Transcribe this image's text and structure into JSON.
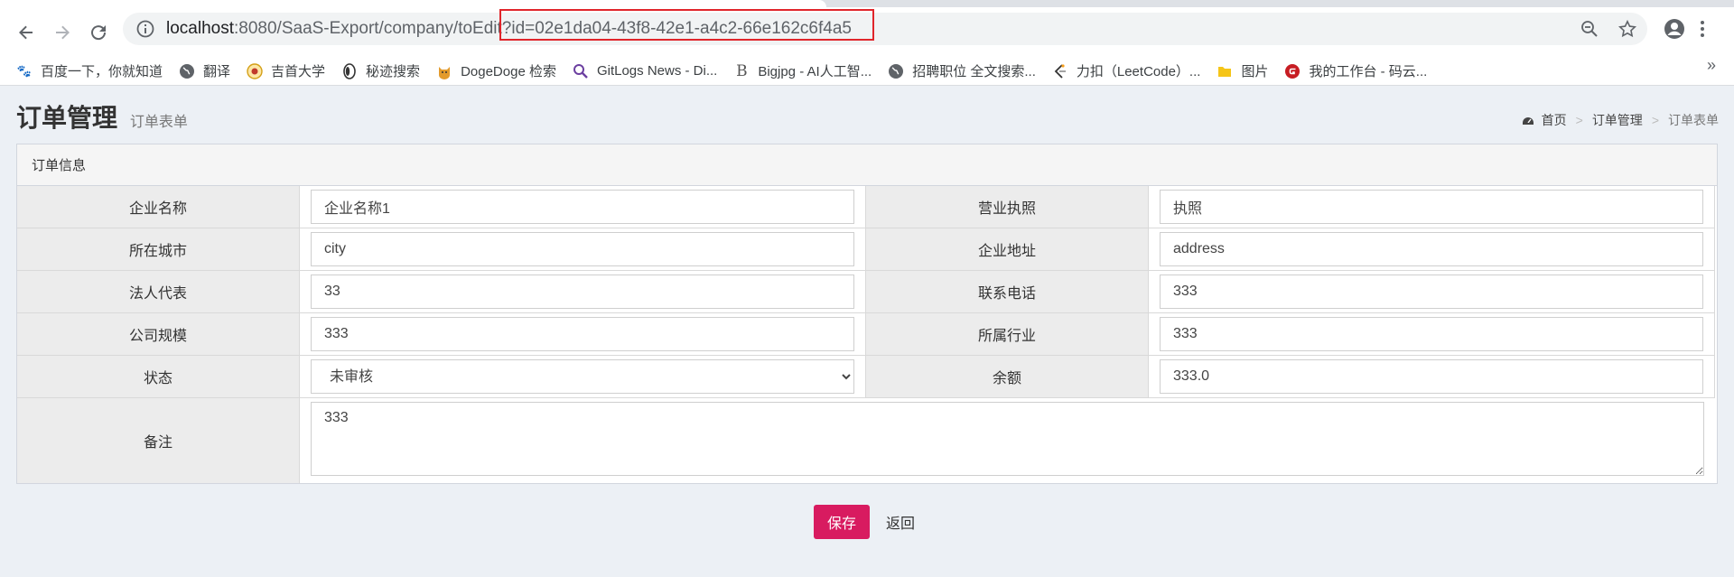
{
  "browser": {
    "url_host": "localhost",
    "url_path": ":8080/SaaS-Export/company/toEdit?id=02e1da04-43f8-42e1-a4c2-66e162c6f4a5",
    "bookmarks": [
      {
        "label": "百度一下，你就知道",
        "icon": "paw-icon",
        "color": "#2932e1"
      },
      {
        "label": "翻译",
        "icon": "globe-icon",
        "color": "#5f6368"
      },
      {
        "label": "吉首大学",
        "icon": "school-emblem-icon",
        "color": "#d4a017"
      },
      {
        "label": "秘迹搜索",
        "icon": "eye-logo-icon",
        "color": "#333333"
      },
      {
        "label": "DogeDoge 检索",
        "icon": "doge-icon",
        "color": "#e39b2c"
      },
      {
        "label": "GitLogs News - Di...",
        "icon": "search-icon",
        "color": "#6b3fa0"
      },
      {
        "label": "Bigjpg - AI人工智...",
        "icon": "b-logo-icon",
        "color": "#555555"
      },
      {
        "label": "招聘职位 全文搜索...",
        "icon": "globe-icon",
        "color": "#5f6368"
      },
      {
        "label": "力扣（LeetCode）...",
        "icon": "leetcode-icon",
        "color": "#f89f1b"
      },
      {
        "label": "图片",
        "icon": "folder-icon",
        "color": "#f5c518"
      },
      {
        "label": "我的工作台 - 码云...",
        "icon": "gitee-icon",
        "color": "#c71d23"
      }
    ]
  },
  "header": {
    "title": "订单管理",
    "subtitle": "订单表单",
    "breadcrumb": {
      "home": "首页",
      "section": "订单管理",
      "current": "订单表单"
    }
  },
  "box": {
    "title": "订单信息"
  },
  "form": {
    "company_name": {
      "label": "企业名称",
      "value": "企业名称1"
    },
    "license": {
      "label": "营业执照",
      "value": "执照"
    },
    "city": {
      "label": "所在城市",
      "value": "city"
    },
    "address": {
      "label": "企业地址",
      "value": "address"
    },
    "legal_rep": {
      "label": "法人代表",
      "value": "33"
    },
    "phone": {
      "label": "联系电话",
      "value": "333"
    },
    "scale": {
      "label": "公司规模",
      "value": "333"
    },
    "industry": {
      "label": "所属行业",
      "value": "333"
    },
    "status": {
      "label": "状态",
      "value": "未审核"
    },
    "balance": {
      "label": "余额",
      "value": "333.0"
    },
    "remark": {
      "label": "备注",
      "value": "333"
    }
  },
  "actions": {
    "save": "保存",
    "back": "返回"
  },
  "colors": {
    "save_button": "#d81b60",
    "url_highlight_border": "#e0252b",
    "page_background": "#ecf0f5"
  }
}
